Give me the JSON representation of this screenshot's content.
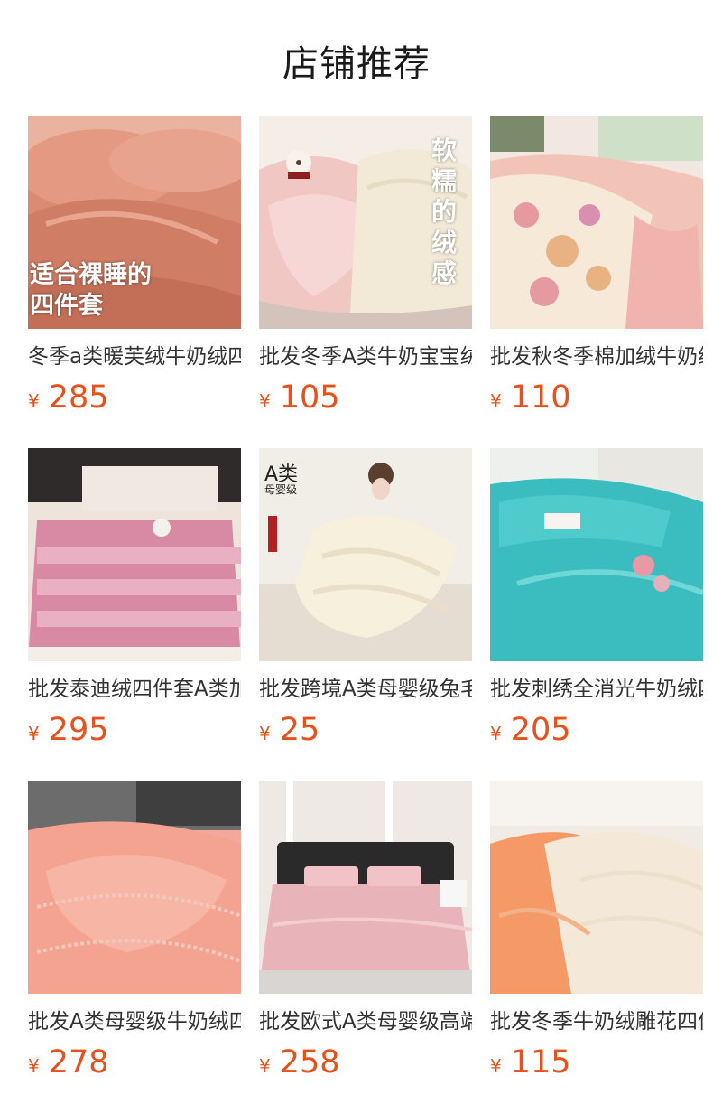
{
  "page_title": "店铺推荐",
  "currency": "¥",
  "products": [
    {
      "name": "冬季a类暖芙绒牛奶绒四件套",
      "price": "285",
      "overlay": "适合裸睡的\n四件套",
      "palette": "rose"
    },
    {
      "name": "批发冬季A类牛奶宝宝绒四件套",
      "price": "105",
      "overlay": "软糯的绒感",
      "palette": "cream"
    },
    {
      "name": "批发秋冬季棉加绒牛奶绒四件套",
      "price": "110",
      "overlay": "",
      "palette": "floral"
    },
    {
      "name": "批发泰迪绒四件套A类加厚",
      "price": "295",
      "overlay": "",
      "palette": "stripe"
    },
    {
      "name": "批发跨境A类母婴级兔毛毯",
      "price": "25",
      "overlay": "",
      "badge_main": "A类",
      "badge_sub": "母婴级",
      "palette": "blanket"
    },
    {
      "name": "批发刺绣全消光牛奶绒四件套",
      "price": "205",
      "overlay": "",
      "palette": "teal"
    },
    {
      "name": "批发A类母婴级牛奶绒四件套",
      "price": "278",
      "overlay": "",
      "palette": "peach"
    },
    {
      "name": "批发欧式A类母婴级高端四件套",
      "price": "258",
      "overlay": "",
      "palette": "pink"
    },
    {
      "name": "批发冬季牛奶绒雕花四件套",
      "price": "115",
      "overlay": "",
      "palette": "orange"
    }
  ],
  "colors": {
    "price": "#e8501c",
    "title": "#1a1a1a"
  }
}
